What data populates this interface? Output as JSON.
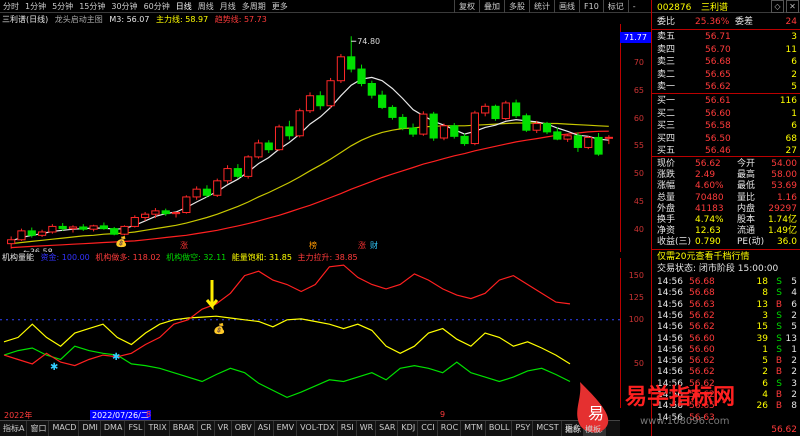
{
  "topbar": {
    "periods": [
      "分时",
      "1分钟",
      "5分钟",
      "15分钟",
      "30分钟",
      "60分钟",
      "日线",
      "周线",
      "月线",
      "多周期",
      "更多"
    ],
    "active_index": 6,
    "tools": [
      "复权",
      "叠加",
      "多股",
      "统计",
      "画线",
      "F10",
      "标记",
      "-"
    ],
    "window_ctrls": [
      "◇",
      "✕"
    ]
  },
  "stock_line": {
    "name": "三利谱(日线)",
    "indicator": "龙头启动主图",
    "m3_label": "M3: 56.07",
    "main_force": "主力线: 58.97",
    "trend": "趋势线: 57.73"
  },
  "sub_line": {
    "name": "机构量能",
    "blue_label": "资金: 100.00",
    "inst_buy": "机构做多: 118.02",
    "inst_short": "机构做空: 32.11",
    "energy": "能量饱和: 31.85",
    "main_pull": "主力拉升: 38.85"
  },
  "chart_data": {
    "type": "candlestick",
    "x": [
      1,
      2,
      3,
      4,
      5,
      6,
      7,
      8,
      9,
      10,
      11,
      12,
      13,
      14,
      15,
      16,
      17,
      18,
      19,
      20,
      21,
      22,
      23,
      24,
      25,
      26,
      27,
      28,
      29,
      30,
      31,
      32,
      33,
      34,
      35,
      36,
      37,
      38,
      39,
      40,
      41,
      42,
      43,
      44,
      45,
      46,
      47,
      48,
      49,
      50,
      51,
      52,
      53,
      54,
      55,
      56,
      57,
      58,
      59
    ],
    "candles": [
      [
        37.5,
        38.8,
        36.6,
        38.2
      ],
      [
        38.2,
        40.2,
        38.0,
        39.8
      ],
      [
        39.8,
        40.4,
        38.6,
        39.0
      ],
      [
        39.0,
        40.0,
        38.7,
        39.6
      ],
      [
        39.6,
        41.0,
        39.3,
        40.6
      ],
      [
        40.6,
        41.2,
        39.8,
        40.2
      ],
      [
        40.2,
        40.8,
        39.5,
        40.5
      ],
      [
        40.5,
        41.0,
        39.8,
        40.1
      ],
      [
        40.1,
        40.9,
        39.7,
        40.7
      ],
      [
        40.7,
        41.3,
        40.0,
        40.2
      ],
      [
        40.2,
        40.5,
        39.0,
        39.2
      ],
      [
        39.2,
        40.8,
        39.0,
        40.6
      ],
      [
        40.6,
        42.6,
        40.4,
        42.2
      ],
      [
        42.2,
        43.2,
        41.6,
        42.8
      ],
      [
        42.8,
        43.9,
        42.1,
        43.4
      ],
      [
        43.4,
        43.8,
        42.5,
        42.9
      ],
      [
        42.9,
        43.2,
        42.2,
        43.1
      ],
      [
        43.1,
        46.2,
        42.9,
        45.9
      ],
      [
        45.9,
        47.8,
        45.4,
        47.3
      ],
      [
        47.3,
        48.0,
        45.8,
        46.2
      ],
      [
        46.2,
        49.2,
        45.9,
        48.8
      ],
      [
        48.8,
        51.6,
        48.3,
        51.0
      ],
      [
        51.0,
        51.8,
        49.2,
        49.6
      ],
      [
        49.6,
        53.4,
        49.2,
        53.1
      ],
      [
        53.1,
        56.2,
        52.8,
        55.6
      ],
      [
        55.6,
        56.1,
        53.8,
        54.4
      ],
      [
        54.4,
        58.9,
        54.2,
        58.5
      ],
      [
        58.5,
        59.6,
        56.2,
        56.9
      ],
      [
        56.9,
        61.8,
        56.6,
        61.4
      ],
      [
        61.4,
        64.7,
        61.0,
        64.1
      ],
      [
        64.1,
        64.9,
        61.6,
        62.3
      ],
      [
        62.3,
        67.3,
        61.9,
        66.8
      ],
      [
        66.8,
        71.6,
        66.4,
        71.1
      ],
      [
        71.1,
        74.8,
        68.3,
        68.9
      ],
      [
        68.9,
        69.7,
        65.8,
        66.3
      ],
      [
        66.3,
        66.8,
        63.6,
        64.2
      ],
      [
        64.2,
        65.0,
        61.7,
        62.0
      ],
      [
        62.0,
        62.4,
        59.8,
        60.2
      ],
      [
        60.2,
        60.8,
        57.9,
        58.3
      ],
      [
        58.3,
        59.1,
        56.7,
        57.2
      ],
      [
        57.2,
        61.3,
        56.9,
        60.8
      ],
      [
        60.8,
        61.2,
        56.0,
        56.5
      ],
      [
        56.5,
        59.1,
        56.1,
        58.7
      ],
      [
        58.7,
        59.2,
        56.4,
        56.8
      ],
      [
        56.8,
        57.3,
        55.1,
        55.5
      ],
      [
        55.5,
        61.4,
        55.2,
        61.0
      ],
      [
        61.0,
        62.7,
        60.4,
        62.2
      ],
      [
        62.2,
        62.5,
        59.6,
        60.0
      ],
      [
        60.0,
        63.2,
        59.7,
        62.8
      ],
      [
        62.8,
        63.4,
        60.1,
        60.5
      ],
      [
        60.5,
        60.9,
        57.6,
        57.9
      ],
      [
        57.9,
        59.6,
        57.4,
        59.1
      ],
      [
        59.1,
        59.4,
        57.2,
        57.6
      ],
      [
        57.6,
        58.4,
        56.1,
        56.3
      ],
      [
        56.3,
        57.1,
        55.8,
        56.9
      ],
      [
        56.9,
        57.5,
        54.0,
        54.8
      ],
      [
        54.8,
        56.9,
        54.5,
        56.6
      ],
      [
        56.6,
        57.4,
        53.3,
        53.6
      ],
      [
        56.6,
        57.0,
        55.4,
        56.62
      ]
    ],
    "highlight_high": "74.80",
    "highlight_low": "36.58",
    "ma_short": [
      38.0,
      38.6,
      39.0,
      39.3,
      39.7,
      39.9,
      40.1,
      40.2,
      40.3,
      40.3,
      40.1,
      40.2,
      40.8,
      41.6,
      42.4,
      42.9,
      43.2,
      44.0,
      45.0,
      45.9,
      46.9,
      48.1,
      49.1,
      50.4,
      51.9,
      53.0,
      54.5,
      55.7,
      57.2,
      59.0,
      60.3,
      62.0,
      64.1,
      66.0,
      67.1,
      67.4,
      66.8,
      65.4,
      63.6,
      61.6,
      60.5,
      59.5,
      58.8,
      58.0,
      57.2,
      57.7,
      58.4,
      58.8,
      59.5,
      59.8,
      59.6,
      59.4,
      59.0,
      58.3,
      57.7,
      57.0,
      56.8,
      56.3,
      56.1
    ],
    "ma_mid": [
      37.5,
      37.7,
      37.9,
      38.1,
      38.3,
      38.5,
      38.7,
      38.9,
      39.0,
      39.2,
      39.3,
      39.4,
      39.6,
      39.9,
      40.2,
      40.5,
      40.8,
      41.2,
      41.7,
      42.2,
      42.8,
      43.5,
      44.2,
      45.0,
      45.9,
      46.7,
      47.6,
      48.5,
      49.5,
      50.6,
      51.6,
      52.7,
      53.9,
      55.1,
      56.1,
      56.9,
      57.5,
      57.9,
      58.2,
      58.3,
      58.5,
      58.6,
      58.7,
      58.7,
      58.7,
      58.8,
      58.9,
      59.0,
      59.1,
      59.2,
      59.2,
      59.2,
      59.1,
      59.1,
      59.0,
      58.9,
      58.8,
      58.7,
      58.6
    ],
    "ma_long": [
      36.8,
      36.9,
      37.0,
      37.1,
      37.2,
      37.3,
      37.4,
      37.5,
      37.6,
      37.7,
      37.8,
      37.9,
      38.0,
      38.2,
      38.4,
      38.6,
      38.8,
      39.0,
      39.3,
      39.6,
      39.9,
      40.3,
      40.7,
      41.1,
      41.6,
      42.1,
      42.6,
      43.2,
      43.8,
      44.4,
      45.1,
      45.8,
      46.5,
      47.3,
      48.0,
      48.7,
      49.4,
      50.0,
      50.6,
      51.2,
      51.8,
      52.3,
      52.8,
      53.3,
      53.7,
      54.2,
      54.6,
      55.0,
      55.4,
      55.8,
      56.1,
      56.4,
      56.7,
      57.0,
      57.2,
      57.4,
      57.6,
      57.7,
      57.73
    ],
    "ylim": [
      36,
      77
    ],
    "yticks": [
      40,
      45,
      50,
      55,
      60,
      65,
      70
    ],
    "sub_ylim": [
      0,
      170
    ],
    "sub_yticks": [
      50,
      100,
      125,
      150
    ],
    "sub_red": [
      60,
      55,
      50,
      62,
      52,
      48,
      55,
      60,
      58,
      62,
      72,
      80,
      95,
      100,
      112,
      118,
      130,
      150,
      155,
      145,
      140,
      132,
      140,
      160,
      162,
      148,
      140,
      135,
      140,
      152,
      145,
      135,
      128,
      124,
      130,
      145,
      150,
      140,
      130,
      120,
      118
    ],
    "sub_yellow": [
      75,
      80,
      95,
      80,
      70,
      85,
      90,
      95,
      80,
      72,
      85,
      95,
      100,
      102,
      103,
      104,
      102,
      100,
      98,
      92,
      100,
      101,
      98,
      95,
      90,
      95,
      88,
      70,
      62,
      70,
      85,
      90,
      78,
      70,
      85,
      80,
      70,
      75,
      68,
      60,
      50
    ],
    "sub_green": [
      60,
      65,
      68,
      60,
      55,
      70,
      65,
      62,
      60,
      50,
      48,
      45,
      40,
      35,
      30,
      38,
      45,
      40,
      28,
      20,
      12,
      18,
      25,
      32,
      30,
      35,
      40,
      32,
      45,
      48,
      45,
      40,
      52,
      40,
      35,
      30,
      35,
      42,
      45,
      38,
      30
    ]
  },
  "axis_label_box": "71.77",
  "quote": {
    "code": "002876",
    "name": "三利谱",
    "weibi_label": "委比",
    "weibi_val": "25.36%",
    "weicha_label": "委差",
    "weicha_val": "24",
    "asks": [
      {
        "label": "卖五",
        "price": "56.71",
        "vol": "3"
      },
      {
        "label": "卖四",
        "price": "56.70",
        "vol": "11"
      },
      {
        "label": "卖三",
        "price": "56.68",
        "vol": "6"
      },
      {
        "label": "卖二",
        "price": "56.65",
        "vol": "2"
      },
      {
        "label": "卖一",
        "price": "56.62",
        "vol": "5"
      }
    ],
    "bids": [
      {
        "label": "买一",
        "price": "56.61",
        "vol": "116"
      },
      {
        "label": "买二",
        "price": "56.60",
        "vol": "1"
      },
      {
        "label": "买三",
        "price": "56.58",
        "vol": "6"
      },
      {
        "label": "买四",
        "price": "56.50",
        "vol": "68"
      },
      {
        "label": "买五",
        "price": "56.46",
        "vol": "27"
      }
    ],
    "stats": [
      {
        "l1": "现价",
        "v1": "56.62",
        "l2": "今开",
        "v2": "54.00"
      },
      {
        "l1": "涨跌",
        "v1": "2.49",
        "l2": "最高",
        "v2": "58.00"
      },
      {
        "l1": "涨幅",
        "v1": "4.60%",
        "l2": "最低",
        "v2": "53.69"
      },
      {
        "l1": "总量",
        "v1": "70480",
        "l2": "量比",
        "v2": "1.16"
      },
      {
        "l1": "外盘",
        "v1": "41183",
        "l2": "内盘",
        "v2": "29297"
      },
      {
        "l1": "换手",
        "v1": "4.74%",
        "l2": "股本",
        "v2": "1.74亿"
      },
      {
        "l1": "净资",
        "v1": "12.63",
        "l2": "流通",
        "v2": "1.49亿"
      },
      {
        "l1": "收益(三)",
        "v1": "0.790",
        "l2": "PE(动)",
        "v2": "36.0"
      }
    ],
    "promo": "仅需20元查看千档行情",
    "trade_state": "交易状态: 闭市阶段 15:00:00",
    "ticks": [
      {
        "t": "14:56",
        "p": "56.68",
        "v": "18",
        "d": "S",
        "n": "5"
      },
      {
        "t": "14:56",
        "p": "56.68",
        "v": "8",
        "d": "S",
        "n": "4"
      },
      {
        "t": "14:56",
        "p": "56.63",
        "v": "13",
        "d": "B",
        "n": "6"
      },
      {
        "t": "14:56",
        "p": "56.62",
        "v": "3",
        "d": "S",
        "n": "2"
      },
      {
        "t": "14:56",
        "p": "56.62",
        "v": "15",
        "d": "S",
        "n": "5"
      },
      {
        "t": "14:56",
        "p": "56.60",
        "v": "39",
        "d": "S",
        "n": "13"
      },
      {
        "t": "14:56",
        "p": "56.60",
        "v": "1",
        "d": "S",
        "n": "1"
      },
      {
        "t": "14:56",
        "p": "56.62",
        "v": "5",
        "d": "B",
        "n": "2"
      },
      {
        "t": "14:56",
        "p": "56.62",
        "v": "2",
        "d": "B",
        "n": "2"
      },
      {
        "t": "14:56",
        "p": "56.62",
        "v": "6",
        "d": "S",
        "n": "3"
      },
      {
        "t": "14:56",
        "p": "56.62",
        "v": "4",
        "d": "B",
        "n": "2"
      },
      {
        "t": "14:56",
        "p": "56.65",
        "v": "26",
        "d": "B",
        "n": "8"
      },
      {
        "t": "14:56",
        "p": "56.63",
        "v": "",
        "d": "",
        "n": ""
      }
    ],
    "last_row_price": "56.62"
  },
  "markers": {
    "zhang": "涨",
    "ban": "榜",
    "zhang2": "涨",
    "cai": "财"
  },
  "datebar": {
    "year": "2022年",
    "date": "2022/07/26/二",
    "n1": "8",
    "n2": "9"
  },
  "bottomtabs": [
    "指标A",
    "窗口",
    "MACD",
    "DMI",
    "DMA",
    "FSL",
    "TRIX",
    "BRAR",
    "CR",
    "VR",
    "OBV",
    "ASI",
    "EMV",
    "VOL-TDX",
    "RSI",
    "WR",
    "SAR",
    "KDJ",
    "CCI",
    "ROC",
    "MTM",
    "BOLL",
    "PSY",
    "MCST",
    "更多",
    "设置"
  ],
  "bottom_active": 25,
  "watermark": {
    "text": "易学指标网",
    "url": "www.108096.com",
    "glyph": "易"
  },
  "extra_tabs": [
    "指标",
    "模板"
  ]
}
